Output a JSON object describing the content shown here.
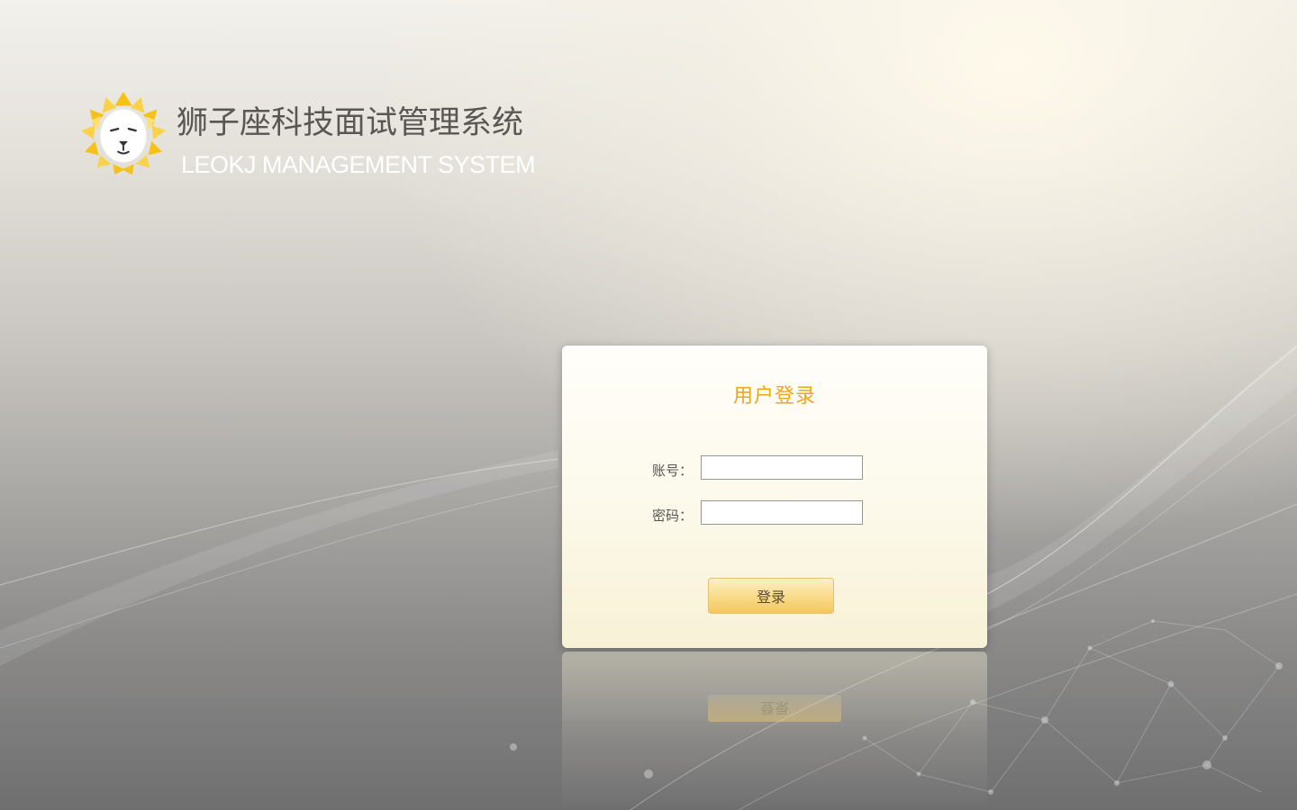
{
  "brand": {
    "title_cn": "狮子座科技面试管理系统",
    "title_en": "LEOKJ MANAGEMENT SYSTEM",
    "logo_icon": "lion-head-icon",
    "accent_color": "#f5c21a"
  },
  "login": {
    "title": "用户登录",
    "account_label": "账号：",
    "account_value": "",
    "password_label": "密码：",
    "password_value": "",
    "submit_label": "登录",
    "title_color": "#f2a614"
  }
}
